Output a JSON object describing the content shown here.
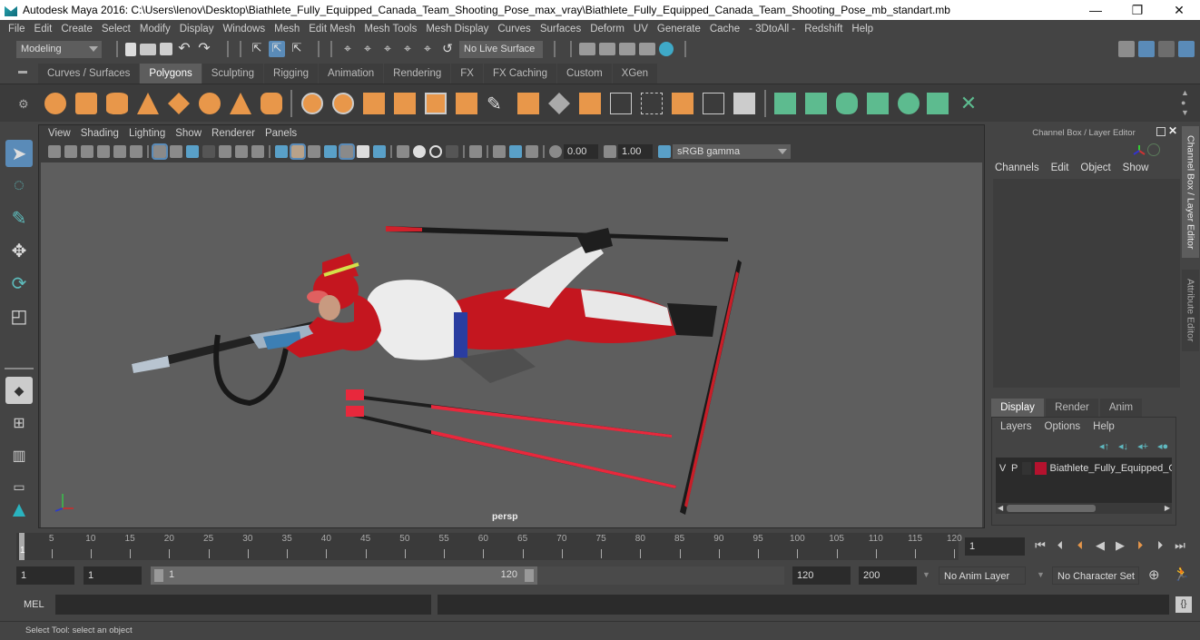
{
  "window": {
    "title": "Autodesk Maya 2016: C:\\Users\\lenov\\Desktop\\Biathlete_Fully_Equipped_Canada_Team_Shooting_Pose_max_vray\\Biathlete_Fully_Equipped_Canada_Team_Shooting_Pose_mb_standart.mb",
    "controls": {
      "minimize": "—",
      "restore": "❐",
      "close": "✕"
    }
  },
  "menubar": [
    "File",
    "Edit",
    "Create",
    "Select",
    "Modify",
    "Display",
    "Windows",
    "Mesh",
    "Edit Mesh",
    "Mesh Tools",
    "Mesh Display",
    "Curves",
    "Surfaces",
    "Deform",
    "UV",
    "Generate",
    "Cache",
    "- 3DtoAll -",
    "Redshift",
    "Help"
  ],
  "statusline": {
    "mode": "Modeling",
    "live_surface": "No Live Surface"
  },
  "shelf": {
    "tabs": [
      "Curves / Surfaces",
      "Polygons",
      "Sculpting",
      "Rigging",
      "Animation",
      "Rendering",
      "FX",
      "FX Caching",
      "Custom",
      "XGen"
    ],
    "active_tab": "Polygons"
  },
  "panel": {
    "menu": [
      "View",
      "Shading",
      "Lighting",
      "Show",
      "Renderer",
      "Panels"
    ],
    "exposure": "0.00",
    "gamma": "1.00",
    "color_space": "sRGB gamma",
    "camera": "persp"
  },
  "channel_box": {
    "title": "Channel Box / Layer Editor",
    "menu": [
      "Channels",
      "Edit",
      "Object",
      "Show"
    ]
  },
  "layer_editor": {
    "tabs": [
      "Display",
      "Render",
      "Anim"
    ],
    "active_tab": "Display",
    "menu": [
      "Layers",
      "Options",
      "Help"
    ],
    "layers": [
      {
        "v": "V",
        "p": "P",
        "color": "#b5122e",
        "name": "Biathlete_Fully_Equipped_Ca"
      }
    ]
  },
  "side_tabs": [
    "Channel Box / Layer Editor",
    "Attribute Editor"
  ],
  "timeline": {
    "ticks": [
      5,
      10,
      15,
      20,
      25,
      30,
      35,
      40,
      45,
      50,
      55,
      60,
      65,
      70,
      75,
      80,
      85,
      90,
      95,
      100,
      105,
      110,
      115,
      120
    ],
    "current_frame_marker": "1",
    "current_frame": "1"
  },
  "range": {
    "start": "1",
    "playback_start": "1",
    "slider_start": "1",
    "slider_end": "120",
    "playback_end": "120",
    "end": "200",
    "anim_layer": "No Anim Layer",
    "character_set": "No Character Set"
  },
  "command_line": {
    "label": "MEL",
    "value": ""
  },
  "help_line": "Select Tool: select an object"
}
